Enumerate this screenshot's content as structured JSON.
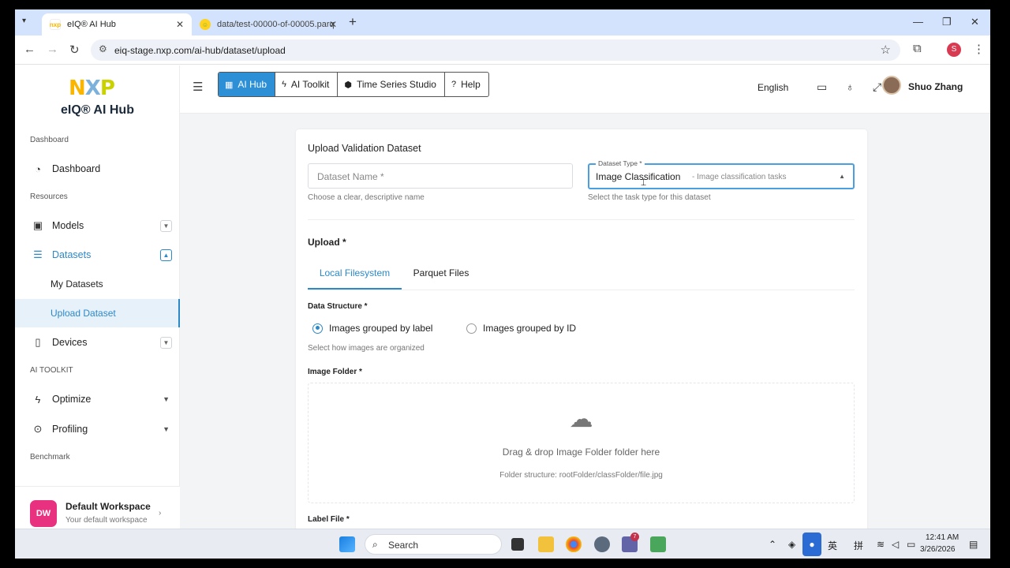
{
  "browser": {
    "tabs": [
      {
        "title": "eIQ® AI Hub"
      },
      {
        "title": "data/test-00000-of-00005.parq"
      }
    ],
    "url": "eiq-stage.nxp.com/ai-hub/dataset/upload",
    "profile_initial": "S"
  },
  "sidebar": {
    "logo_text": "NXP",
    "brand": "eIQ® AI Hub",
    "sections": {
      "dashboard": "Dashboard",
      "resources": "Resources",
      "ai_toolkit": "AI TOOLKIT",
      "benchmark": "Benchmark"
    },
    "items": {
      "dashboard": "Dashboard",
      "models": "Models",
      "datasets": "Datasets",
      "my_datasets": "My Datasets",
      "upload_dataset": "Upload Dataset",
      "devices": "Devices",
      "optimize": "Optimize",
      "profiling": "Profiling"
    },
    "workspace": {
      "initials": "DW",
      "name": "Default Workspace",
      "subtitle": "Your default workspace"
    }
  },
  "topbar": {
    "tools": [
      "AI Hub",
      "AI Toolkit",
      "Time Series Studio",
      "Help"
    ],
    "language": "English",
    "user": "Shuo Zhang"
  },
  "form": {
    "title": "Upload Validation Dataset",
    "name_placeholder": "Dataset Name *",
    "name_help": "Choose a clear, descriptive name",
    "type_label": "Dataset Type *",
    "type_value": "Image Classification",
    "type_desc": "- Image classification tasks",
    "type_help": "Select the task type for this dataset",
    "upload_label": "Upload *",
    "tabs": [
      "Local Filesystem",
      "Parquet Files"
    ],
    "data_structure_label": "Data Structure *",
    "radio_label": "Images grouped by label",
    "radio_id": "Images grouped by ID",
    "data_structure_help": "Select how images are organized",
    "image_folder_label": "Image Folder *",
    "dropzone_text": "Drag & drop Image Folder folder here",
    "dropzone_structure": "Folder structure: rootFolder/classFolder/file.jpg",
    "label_file_label": "Label File *"
  },
  "taskbar": {
    "search": "Search",
    "ime_lang": "英",
    "ime_mode": "拼",
    "notification_count": "7",
    "time": "12:41 AM",
    "date": "3/26/2026"
  },
  "colors": {
    "accent": "#2c89c8",
    "primary_button": "#2d8fd6",
    "workspace_avatar": "#e8327f"
  }
}
